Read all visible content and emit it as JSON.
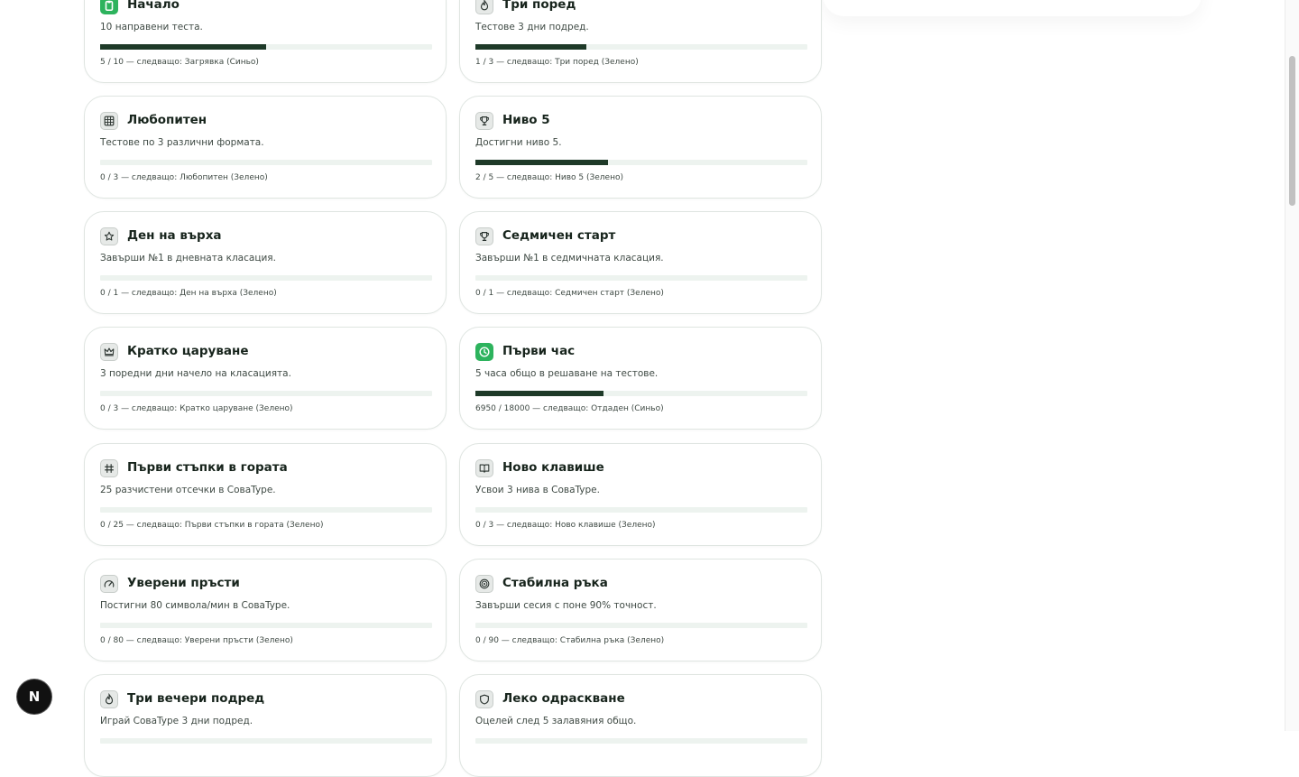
{
  "achievements": [
    {
      "title": "Начало",
      "description": "10 направени теста.",
      "progress": "5 / 10 — следващо: Загрявка (Синьо)",
      "progress_fraction": 0.5,
      "icon": "clipboard-icon",
      "active": true
    },
    {
      "title": "Три поред",
      "description": "Тестове 3 дни подред.",
      "progress": "1 / 3 — следващо: Три поред (Зелено)",
      "progress_fraction": 0.333,
      "icon": "flame-icon",
      "active": false
    },
    {
      "title": "Любопитен",
      "description": "Тестове по 3 различни формата.",
      "progress": "0 / 3 — следващо: Любопитен (Зелено)",
      "progress_fraction": 0,
      "icon": "grid-icon",
      "active": false
    },
    {
      "title": "Ниво 5",
      "description": "Достигни ниво 5.",
      "progress": "2 / 5 — следващо: Ниво 5 (Зелено)",
      "progress_fraction": 0.4,
      "icon": "trophy-icon",
      "active": false
    },
    {
      "title": "Ден на върха",
      "description": "Завърши №1 в дневната класация.",
      "progress": "0 / 1 — следващо: Ден на върха (Зелено)",
      "progress_fraction": 0,
      "icon": "star-icon",
      "active": false
    },
    {
      "title": "Седмичен старт",
      "description": "Завърши №1 в седмичната класация.",
      "progress": "0 / 1 — следващо: Седмичен старт (Зелено)",
      "progress_fraction": 0,
      "icon": "trophy-icon",
      "active": false
    },
    {
      "title": "Кратко царуване",
      "description": "3 поредни дни начело на класацията.",
      "progress": "0 / 3 — следващо: Кратко царуване (Зелено)",
      "progress_fraction": 0,
      "icon": "crown-icon",
      "active": false
    },
    {
      "title": "Първи час",
      "description": "5 часа общо в решаване на тестове.",
      "progress": "6950 / 18000 — следващо: Отдаден (Синьо)",
      "progress_fraction": 0.386,
      "icon": "clock-icon",
      "active": true
    },
    {
      "title": "Първи стъпки в гората",
      "description": "25 разчистени отсечки в СоваType.",
      "progress": "0 / 25 — следващо: Първи стъпки в гората (Зелено)",
      "progress_fraction": 0,
      "icon": "hash-icon",
      "active": false
    },
    {
      "title": "Ново клавише",
      "description": "Усвои 3 нива в СоваType.",
      "progress": "0 / 3 — следващо: Ново клавише (Зелено)",
      "progress_fraction": 0,
      "icon": "book-icon",
      "active": false
    },
    {
      "title": "Уверени пръсти",
      "description": "Постигни 80 символа/мин в СоваType.",
      "progress": "0 / 80 — следващо: Уверени пръсти (Зелено)",
      "progress_fraction": 0,
      "icon": "gauge-icon",
      "active": false
    },
    {
      "title": "Стабилна ръка",
      "description": "Завърши сесия с поне 90% точност.",
      "progress": "0 / 90 — следващо: Стабилна ръка (Зелено)",
      "progress_fraction": 0,
      "icon": "target-icon",
      "active": false
    },
    {
      "title": "Три вечери подред",
      "description": "Играй СоваType 3 дни подред.",
      "progress": "",
      "progress_fraction": 0,
      "icon": "flame-icon",
      "active": false
    },
    {
      "title": "Леко одраскване",
      "description": "Оцелей след 5 залавяния общо.",
      "progress": "",
      "progress_fraction": 0,
      "icon": "shield-icon",
      "active": false
    }
  ],
  "floating_badge": {
    "label": "N"
  },
  "colors": {
    "accent": "#2db35d",
    "progress_fill": "#1e3a28",
    "progress_track": "#edf3ef"
  }
}
